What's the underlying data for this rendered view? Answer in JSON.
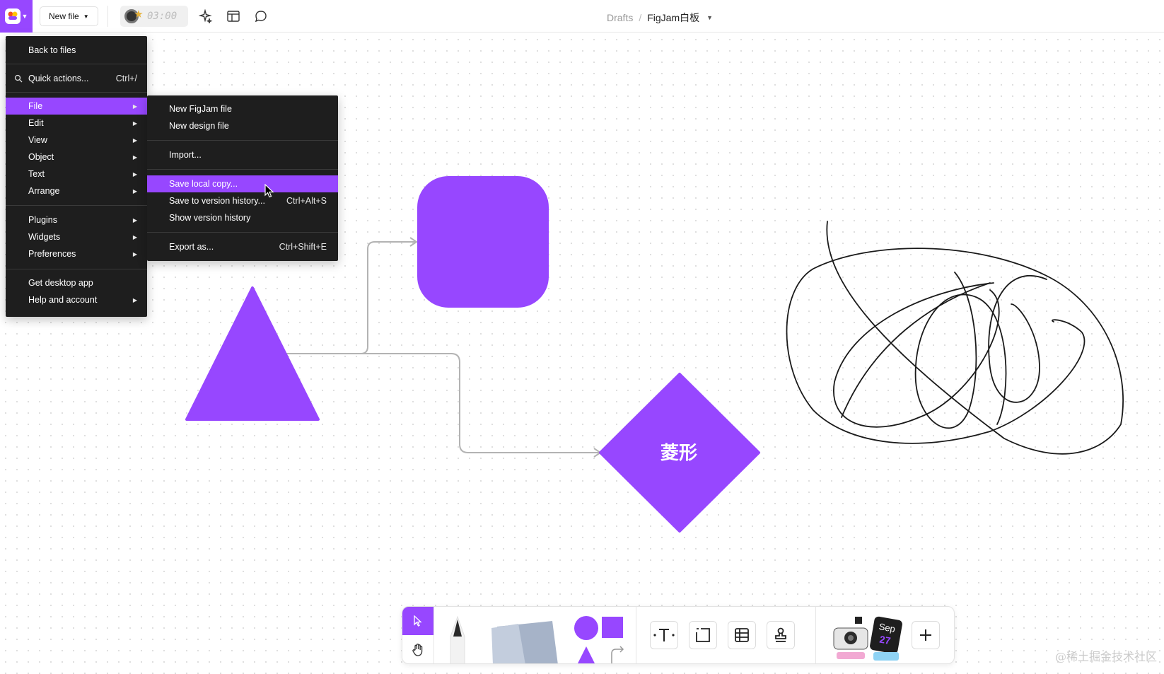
{
  "topbar": {
    "new_file_label": "New file",
    "timer_text": "03:00",
    "breadcrumb": {
      "drafts": "Drafts",
      "separator": "/",
      "file_title": "FigJam白板"
    }
  },
  "main_menu": {
    "back_to_files": "Back to files",
    "quick_actions": {
      "label": "Quick actions...",
      "shortcut": "Ctrl+/"
    },
    "items": [
      {
        "label": "File"
      },
      {
        "label": "Edit"
      },
      {
        "label": "View"
      },
      {
        "label": "Object"
      },
      {
        "label": "Text"
      },
      {
        "label": "Arrange"
      },
      {
        "label": "Plugins"
      },
      {
        "label": "Widgets"
      },
      {
        "label": "Preferences"
      },
      {
        "label": "Get desktop app"
      },
      {
        "label": "Help and account"
      }
    ]
  },
  "file_submenu": {
    "items": [
      {
        "label": "New FigJam file",
        "shortcut": ""
      },
      {
        "label": "New design file",
        "shortcut": ""
      },
      {
        "label": "Import...",
        "shortcut": ""
      },
      {
        "label": "Save local copy...",
        "shortcut": ""
      },
      {
        "label": "Save to version history...",
        "shortcut": "Ctrl+Alt+S"
      },
      {
        "label": "Show version history",
        "shortcut": ""
      },
      {
        "label": "Export as...",
        "shortcut": "Ctrl+Shift+E"
      }
    ]
  },
  "canvas": {
    "diamond_label": "菱形",
    "shape_color": "#9747ff"
  },
  "toolbar": {
    "tools": [
      "select-tool",
      "hand-tool",
      "pen-tool",
      "sticky-note-tool",
      "shapes-tool",
      "text-tool",
      "section-tool",
      "table-tool",
      "stamp-tool",
      "stickers-tool",
      "more-tools"
    ],
    "stickers_date_month": "Sep",
    "stickers_date_day": "27"
  },
  "watermark": "@稀土掘金技术社区",
  "colors": {
    "accent": "#9747ff",
    "menu_bg": "#1e1e1e"
  }
}
